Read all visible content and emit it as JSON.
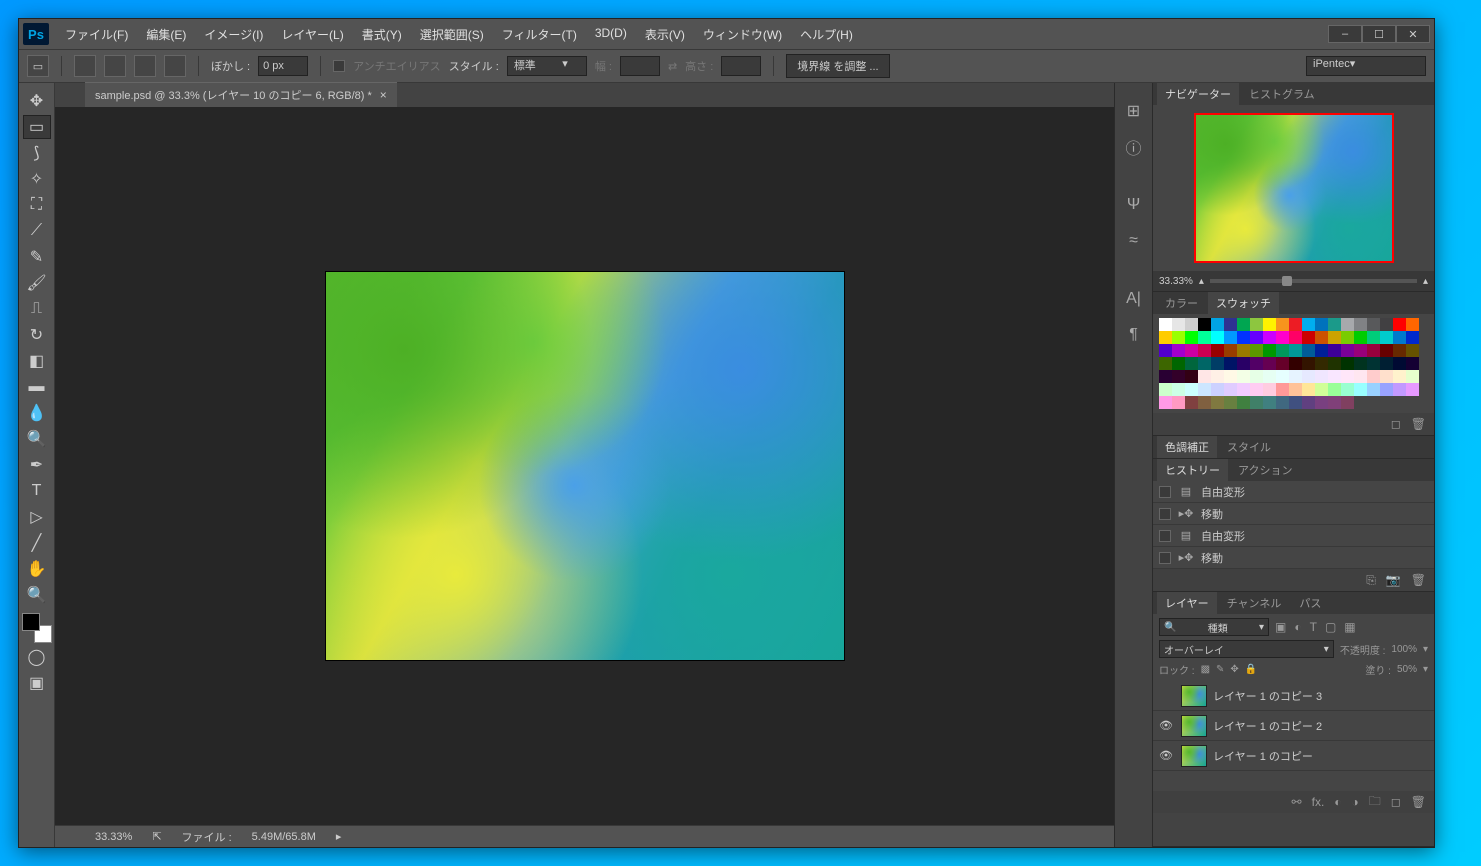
{
  "app": {
    "logo": "Ps"
  },
  "menu": [
    "ファイル(F)",
    "編集(E)",
    "イメージ(I)",
    "レイヤー(L)",
    "書式(Y)",
    "選択範囲(S)",
    "フィルター(T)",
    "3D(D)",
    "表示(V)",
    "ウィンドウ(W)",
    "ヘルプ(H)"
  ],
  "window_controls": [
    "–",
    "☐",
    "✕"
  ],
  "options": {
    "feather_label": "ぼかし :",
    "feather_value": "0 px",
    "antialias": "アンチエイリアス",
    "style_label": "スタイル :",
    "style_value": "標準",
    "width_label": "幅 :",
    "height_label": "高さ :",
    "refine_edge": "境界線 を調整 ...",
    "workspace": "iPentec"
  },
  "document": {
    "tab_title": "sample.psd @ 33.3% (レイヤー 10 のコピー 6, RGB/8) *"
  },
  "status": {
    "zoom": "33.33%",
    "file_label": "ファイル :",
    "file_value": "5.49M/65.8M"
  },
  "panels": {
    "navigator": {
      "tabs": [
        "ナビゲーター",
        "ヒストグラム"
      ],
      "zoom": "33.33%"
    },
    "swatches": {
      "tabs": [
        "カラー",
        "スウォッチ"
      ]
    },
    "adjustments": {
      "tabs": [
        "色調補正",
        "スタイル"
      ]
    },
    "history": {
      "tabs": [
        "ヒストリー",
        "アクション"
      ],
      "items": [
        {
          "icon": "doc",
          "label": "自由変形"
        },
        {
          "icon": "move",
          "label": "移動"
        },
        {
          "icon": "doc",
          "label": "自由変形"
        },
        {
          "icon": "move",
          "label": "移動"
        }
      ]
    },
    "layers": {
      "tabs": [
        "レイヤー",
        "チャンネル",
        "パス"
      ],
      "filter_label": "種類",
      "blend_mode": "オーバーレイ",
      "opacity_label": "不透明度 :",
      "opacity_value": "100%",
      "lock_label": "ロック :",
      "fill_label": "塗り :",
      "fill_value": "50%",
      "items": [
        {
          "visible": false,
          "name": "レイヤー 1 のコピー 3"
        },
        {
          "visible": true,
          "name": "レイヤー 1 のコピー 2"
        },
        {
          "visible": true,
          "name": "レイヤー 1 のコピー"
        }
      ]
    }
  },
  "swatch_colors": [
    "#ffffff",
    "#e6e6e6",
    "#cfcfcf",
    "#000000",
    "#00a4e4",
    "#2e3192",
    "#00a651",
    "#8dc63f",
    "#fff200",
    "#f7941d",
    "#ed1c24",
    "#00aeef",
    "#0072bc",
    "#1b9a8a",
    "#a7a9ac",
    "#808285",
    "#58595b",
    "#414042",
    "#ff0000",
    "#ff6600",
    "#ffcc00",
    "#99ff00",
    "#00ff00",
    "#00ff99",
    "#00ffff",
    "#0099ff",
    "#0033ff",
    "#6600ff",
    "#cc00ff",
    "#ff00cc",
    "#ff0066",
    "#cc0000",
    "#cc5200",
    "#cca300",
    "#7acc00",
    "#00cc00",
    "#00cc7a",
    "#00cccc",
    "#007acc",
    "#0029cc",
    "#5200cc",
    "#a300cc",
    "#cc00a3",
    "#cc0052",
    "#990000",
    "#993d00",
    "#997a00",
    "#5c9900",
    "#009900",
    "#00995c",
    "#009999",
    "#005c99",
    "#001f99",
    "#3d0099",
    "#7a0099",
    "#99007a",
    "#99003d",
    "#660000",
    "#662900",
    "#665200",
    "#3d6600",
    "#006600",
    "#00663d",
    "#006666",
    "#003d66",
    "#001466",
    "#290066",
    "#520066",
    "#660052",
    "#660029",
    "#330000",
    "#331400",
    "#332900",
    "#1f3300",
    "#003300",
    "#00331f",
    "#003333",
    "#001f33",
    "#000a33",
    "#140033",
    "#290033",
    "#330029",
    "#330014",
    "#ffe6e6",
    "#fff0e6",
    "#fff9e6",
    "#f3ffe6",
    "#e6ffe6",
    "#e6fff3",
    "#e6ffff",
    "#e6f3ff",
    "#e6e9ff",
    "#f0e6ff",
    "#f9e6ff",
    "#ffe6f9",
    "#ffe6f0",
    "#ffcccc",
    "#ffe0cc",
    "#fff2cc",
    "#e6ffcc",
    "#ccffcc",
    "#ccffe6",
    "#ccffff",
    "#cce6ff",
    "#ccd1ff",
    "#e0ccff",
    "#f2ccff",
    "#ffccf2",
    "#ffcce0",
    "#ff9999",
    "#ffc299",
    "#ffe699",
    "#d1ff99",
    "#99ff99",
    "#99ffd1",
    "#99ffff",
    "#99d1ff",
    "#99a3ff",
    "#c299ff",
    "#e699ff",
    "#ff99e6",
    "#ff99c2",
    "#804040",
    "#806040",
    "#807940",
    "#688040",
    "#408040",
    "#408068",
    "#408080",
    "#406880",
    "#405080",
    "#604080",
    "#794080",
    "#804079",
    "#804060"
  ]
}
